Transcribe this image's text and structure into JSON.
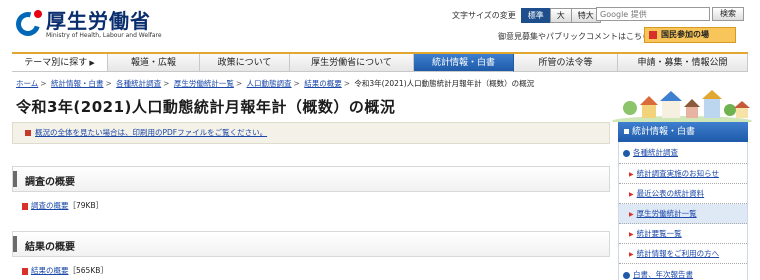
{
  "header": {
    "logo_jp": "厚生労働省",
    "logo_en": "Ministry of Health, Labour and Welfare",
    "font_size_label": "文字サイズの変更",
    "font_sizes": [
      "標準",
      "大",
      "特大"
    ],
    "search_placeholder": "Google 提供",
    "search_button": "検索",
    "opinion_link": "御意見募集やパブリックコメントはこちら",
    "kokumin_button": "国民参加の場"
  },
  "gnav": [
    {
      "label": "テーマ別に探す"
    },
    {
      "label": "報道・広報"
    },
    {
      "label": "政策について"
    },
    {
      "label": "厚生労働省について"
    },
    {
      "label": "統計情報・白書"
    },
    {
      "label": "所管の法令等"
    },
    {
      "label": "申請・募集・情報公開"
    }
  ],
  "breadcrumb": [
    "ホーム",
    "統計情報・白書",
    "各種統計調査",
    "厚生労働統計一覧",
    "人口動態調査",
    "結果の概要",
    "令和3年(2021)人口動態統計月報年計（概数）の概況"
  ],
  "page_title": "令和3年(2021)人口動態統計月報年計（概数）の概況",
  "notice": "概況の全体を見たい場合は、印刷用のPDFファイルをご覧ください。",
  "sections": [
    {
      "title": "調査の概要",
      "file_label": "調査の概要",
      "file_size": "［79KB］"
    },
    {
      "title": "結果の概要",
      "file_label": "結果の概要",
      "file_size": "［565KB］"
    }
  ],
  "sidebar": {
    "heading": "統計情報・白書",
    "items": [
      {
        "label": "各種統計調査",
        "level": 1
      },
      {
        "label": "統計調査実施のお知らせ",
        "level": 2
      },
      {
        "label": "最近公表の統計資料",
        "level": 2
      },
      {
        "label": "厚生労働統計一覧",
        "level": 2
      },
      {
        "label": "統計要覧一覧",
        "level": 2
      },
      {
        "label": "統計情報をご利用の方へ",
        "level": 2
      },
      {
        "label": "白書、年次報告書",
        "level": 1
      }
    ]
  },
  "colors": {
    "brand_blue": "#1e5aa8",
    "accent_orange": "#e0a830",
    "logo_red": "#e60012"
  }
}
